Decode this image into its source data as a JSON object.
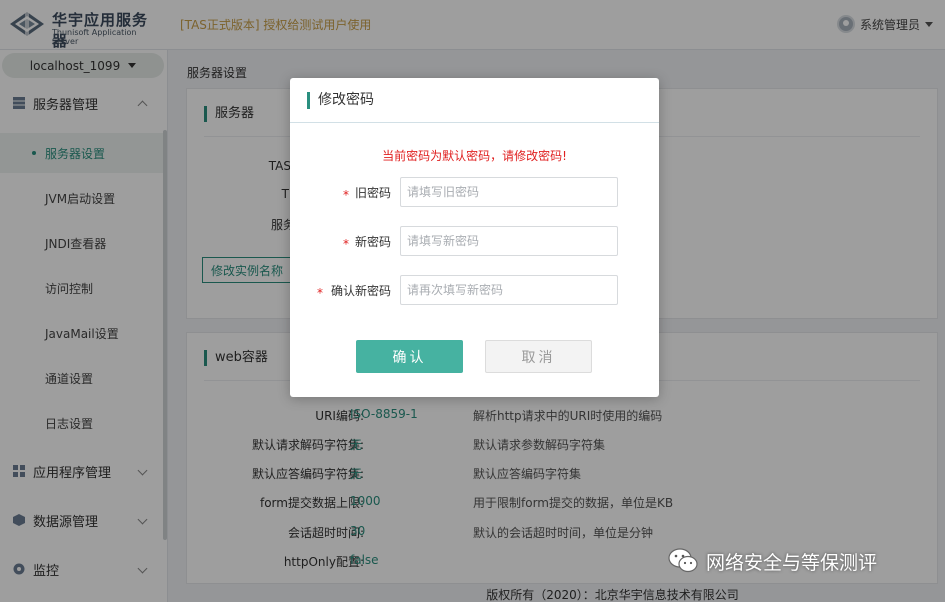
{
  "header": {
    "logo_cn": "华宇应用服务器",
    "logo_en": "Thunisoft Application Server",
    "license_notice": "[TAS正式版本] 授权给测试用户使用",
    "user_name": "系统管理员"
  },
  "sidebar": {
    "host": "localhost_1099",
    "groups": [
      {
        "label": "服务器管理",
        "icon": "server-grid-icon",
        "expanded": true
      },
      {
        "label": "应用程序管理",
        "icon": "apps-grid-icon",
        "expanded": false
      },
      {
        "label": "数据源管理",
        "icon": "database-icon",
        "expanded": false
      },
      {
        "label": "监控",
        "icon": "monitor-icon",
        "expanded": false
      }
    ],
    "items": [
      {
        "label": "服务器设置",
        "active": true
      },
      {
        "label": "JVM启动设置",
        "active": false
      },
      {
        "label": "JNDI查看器",
        "active": false
      },
      {
        "label": "访问控制",
        "active": false
      },
      {
        "label": "JavaMail设置",
        "active": false
      },
      {
        "label": "通道设置",
        "active": false
      },
      {
        "label": "日志设置",
        "active": false
      }
    ]
  },
  "main": {
    "breadcrumb": "服务器设置",
    "server_card": {
      "title": "服务器",
      "visible_labels": [
        "TAS实",
        "T",
        "服务"
      ],
      "rename_button": "修改实例名称"
    },
    "web_card": {
      "title": "web容器",
      "rows": [
        {
          "key": "URI编码:",
          "value": "ISO-8859-1",
          "desc": "解析http请求中的URI时使用的编码"
        },
        {
          "key": "默认请求解码字符集:",
          "value": "无",
          "desc": "默认请求参数解码字符集"
        },
        {
          "key": "默认应答编码字符集:",
          "value": "无",
          "desc": "默认应答编码字符集"
        },
        {
          "key": "form提交数据上限:",
          "value": "1000",
          "desc": "用于限制form提交的数据，单位是KB"
        },
        {
          "key": "会话超时时间:",
          "value": "30",
          "desc": "默认的会话超时时间，单位是分钟"
        },
        {
          "key": "httpOnly配置:",
          "value": "false",
          "desc": ""
        }
      ]
    }
  },
  "footer": "版权所有（2020）：北京华宇信息技术有限公司",
  "modal": {
    "title": "修改密码",
    "warning": "当前密码为默认密码，请修改密码!",
    "fields": [
      {
        "label": "旧密码",
        "placeholder": "请填写旧密码"
      },
      {
        "label": "新密码",
        "placeholder": "请填写新密码"
      },
      {
        "label": "确认新密码",
        "placeholder": "请再次填写新密码"
      }
    ],
    "required_mark": "*",
    "ok_label": "确认",
    "cancel_label": "取消"
  },
  "watermark": "网络安全与等保测评",
  "colors": {
    "accent": "#2a8f7f",
    "primary_button": "#46b2a1",
    "warning": "#e02020",
    "license_text": "#c9a04a"
  }
}
